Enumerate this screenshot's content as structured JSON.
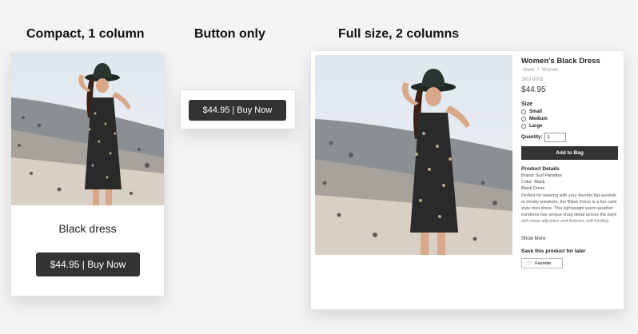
{
  "headings": {
    "compact": "Compact, 1 column",
    "button_only": "Button only",
    "full": "Full size, 2 columns"
  },
  "compact": {
    "title": "Black dress",
    "buy_label": "$44.95 | Buy Now"
  },
  "button_only": {
    "buy_label": "$44.95 | Buy Now"
  },
  "full": {
    "title": "Women's Black Dress",
    "breadcrumb": [
      "Store",
      "/",
      "Women"
    ],
    "sku": "SKU 0008",
    "price": "$44.95",
    "size_label": "Size",
    "sizes": [
      "Small",
      "Medium",
      "Large"
    ],
    "quantity_label": "Quantity:",
    "quantity_value": "1",
    "add_to_bag": "Add to Bag",
    "details_title": "Product Details",
    "brand": "Brand: Surf Paradise",
    "color": "Color: Black",
    "name_line": "Black Dress",
    "description": "Perfect for wearing with your favorite flat sandals or trendy sneakers, the Black Dress is a fun cami style mini dress. This lightweight warm weather sundress has unique strap detail across the back with strap adjusters and features soft binding",
    "show_more": "Show More",
    "save_label": "Save this product for later",
    "favorite": "Favorite"
  },
  "colors": {
    "button_bg": "#333333",
    "page_bg": "#f4f4f4"
  }
}
